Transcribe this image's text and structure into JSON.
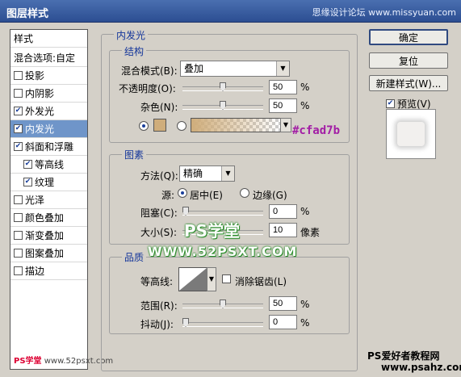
{
  "window": {
    "title": "图层样式",
    "watermark_top": "思缘设计论坛 www.missyuan.com"
  },
  "sidebar": {
    "header": "样式",
    "blend": "混合选项:自定",
    "items": [
      {
        "label": "投影",
        "checked": false
      },
      {
        "label": "内阴影",
        "checked": false
      },
      {
        "label": "外发光",
        "checked": true
      },
      {
        "label": "内发光",
        "checked": true,
        "selected": true
      },
      {
        "label": "斜面和浮雕",
        "checked": true
      },
      {
        "label": "等高线",
        "checked": true,
        "sub": true
      },
      {
        "label": "纹理",
        "checked": true,
        "sub": true
      },
      {
        "label": "光泽",
        "checked": false
      },
      {
        "label": "颜色叠加",
        "checked": false
      },
      {
        "label": "渐变叠加",
        "checked": false
      },
      {
        "label": "图案叠加",
        "checked": false
      },
      {
        "label": "描边",
        "checked": false
      }
    ],
    "watermark": {
      "ps": "PS学堂",
      "url": "www.52psxt.com"
    }
  },
  "panel": {
    "title": "内发光",
    "structure": {
      "title": "结构",
      "blend_mode_label": "混合模式(B):",
      "blend_mode_value": "叠加",
      "opacity_label": "不透明度(O):",
      "opacity_value": "50",
      "opacity_level": 0.5,
      "noise_label": "杂色(N):",
      "noise_value": "50",
      "noise_level": 0.5,
      "percent": "%",
      "color_hex": "#cfad7b",
      "swatch_color": "#cfad7b"
    },
    "elements": {
      "title": "图素",
      "method_label": "方法(Q):",
      "method_value": "精确",
      "source_label": "源:",
      "source_center": "居中(E)",
      "source_edge": "边缘(G)",
      "choke_label": "阻塞(C):",
      "choke_value": "0",
      "choke_level": 0,
      "size_label": "大小(S):",
      "size_value": "10",
      "size_unit": "像素",
      "percent": "%"
    },
    "quality": {
      "title": "品质",
      "contour_label": "等高线:",
      "antialias_label": "消除锯齿(L)",
      "range_label": "范围(R):",
      "range_value": "50",
      "range_level": 0.5,
      "jitter_label": "抖动(J):",
      "jitter_value": "0",
      "jitter_level": 0,
      "percent": "%"
    }
  },
  "buttons": {
    "ok": "确定",
    "reset": "复位",
    "new_style": "新建样式(W)...",
    "preview": "预览(V)",
    "preview_checked": true
  },
  "watermarks": {
    "ps_school": "PS学堂",
    "url": "WWW.52PSXT.COM",
    "bottom_right_cn": "PS爱好者教程网",
    "bottom_right_url": "www.psahz.com"
  },
  "colors": {
    "accent": "#13359a",
    "selected_row": "#6f95c9",
    "hex_text": "#a21da5"
  }
}
